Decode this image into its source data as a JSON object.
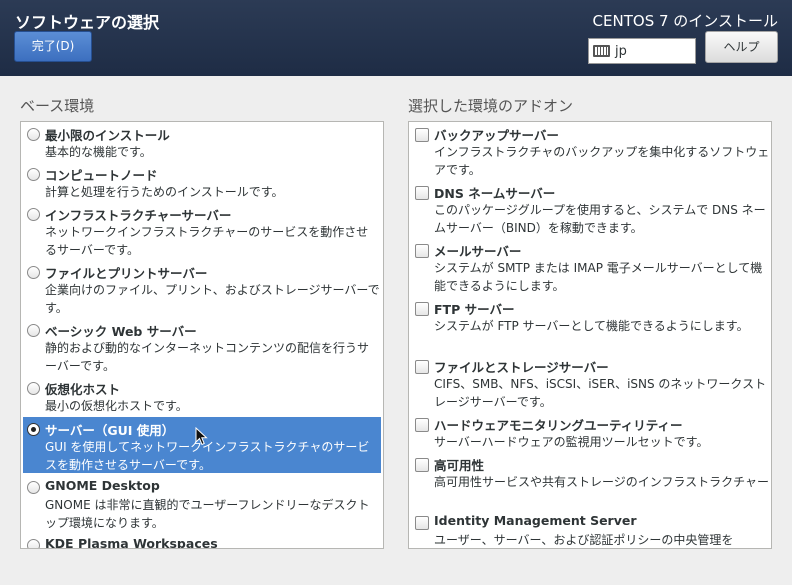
{
  "header": {
    "title": "ソフトウェアの選択",
    "done_label": "完了(D)",
    "product": "CENTOS 7 のインストール",
    "keyboard_layout": "jp",
    "help_label": "ヘルプ"
  },
  "base_env": {
    "title": "ベース環境",
    "selected_index": 6,
    "items": [
      {
        "title": "最小限のインストール",
        "desc": "基本的な機能です。"
      },
      {
        "title": "コンピュートノード",
        "desc": "計算と処理を行うためのインストールです。"
      },
      {
        "title": "インフラストラクチャーサーバー",
        "desc": "ネットワークインフラストラクチャーのサービスを動作させるサーバーです。"
      },
      {
        "title": "ファイルとプリントサーバー",
        "desc": "企業向けのファイル、プリント、およびストレージサーバーです。"
      },
      {
        "title": "ベーシック Web サーバー",
        "desc": "静的および動的なインターネットコンテンツの配信を行うサーバーです。"
      },
      {
        "title": "仮想化ホスト",
        "desc": "最小の仮想化ホストです。"
      },
      {
        "title": "サーバー（GUI 使用）",
        "desc": "GUI を使用してネットワークインフラストラクチャのサービスを動作させるサーバーです。"
      },
      {
        "title": "GNOME Desktop",
        "desc": "GNOME は非常に直観的でユーザーフレンドリーなデスクトップ環境になります。"
      },
      {
        "title": "KDE Plasma Workspaces",
        "desc": ""
      }
    ]
  },
  "addons": {
    "title": "選択した環境のアドオン",
    "items": [
      {
        "title": "バックアップサーバー",
        "desc": "インフラストラクチャのバックアップを集中化するソフトウェアです。",
        "checked": false
      },
      {
        "title": "DNS ネームサーバー",
        "desc": "このパッケージグループを使用すると、システムで DNS ネームサーバー（BIND）を稼動できます。",
        "checked": false
      },
      {
        "title": "メールサーバー",
        "desc": "システムが SMTP または IMAP 電子メールサーバーとして機能できるようにします。",
        "checked": false
      },
      {
        "title": "FTP サーバー",
        "desc": "システムが FTP サーバーとして機能できるようにします。",
        "checked": false
      },
      {
        "title": "ファイルとストレージサーバー",
        "desc": "CIFS、SMB、NFS、iSCSI、iSER、iSNS のネットワークストレージサーバーです。",
        "checked": false
      },
      {
        "title": "ハードウェアモニタリングユーティリティー",
        "desc": "サーバーハードウェアの監視用ツールセットです。",
        "checked": false
      },
      {
        "title": "高可用性",
        "desc": "高可用性サービスや共有ストレージのインフラストラクチャー",
        "checked": false
      },
      {
        "title": "Identity Management Server",
        "desc": "ユーザー、サーバー、および認証ポリシーの中央管理を",
        "checked": false
      }
    ]
  }
}
